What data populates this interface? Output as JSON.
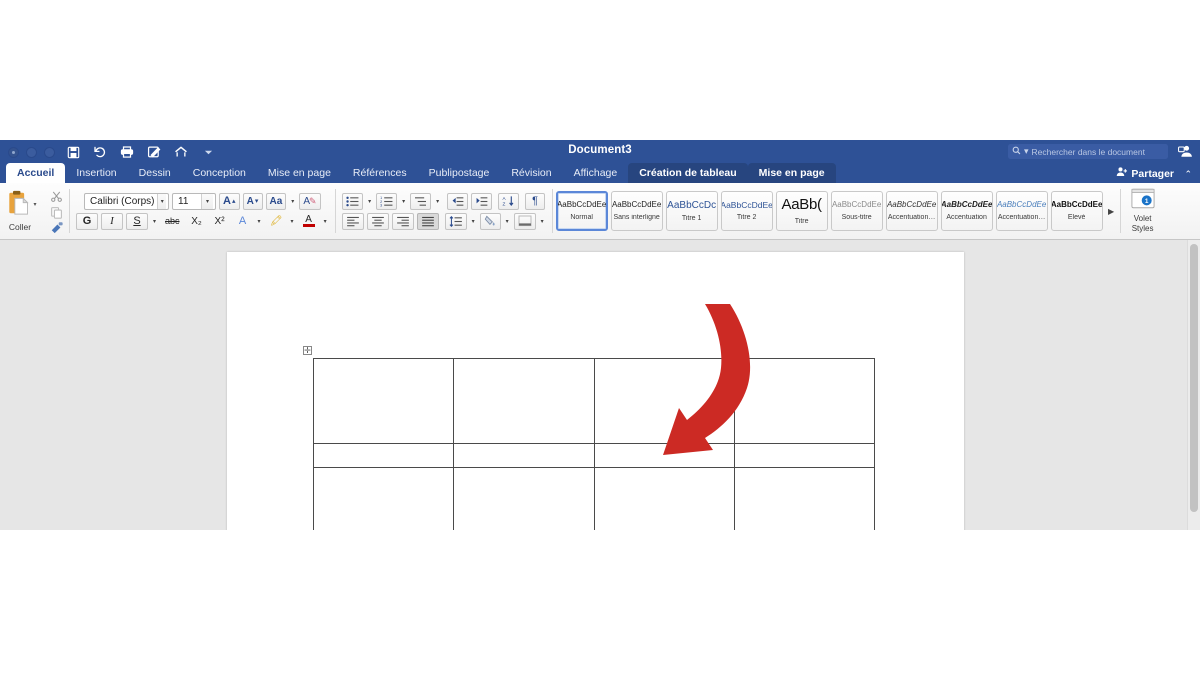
{
  "window": {
    "title": "Document3",
    "traffic_lights": [
      "close",
      "minimize",
      "zoom"
    ]
  },
  "quick_access": [
    {
      "name": "save-icon",
      "label": "Enregistrer"
    },
    {
      "name": "undo-icon",
      "label": "Annuler"
    },
    {
      "name": "print-icon",
      "label": "Imprimer"
    },
    {
      "name": "track-changes-icon",
      "label": "Suivi des modifications"
    },
    {
      "name": "home-icon",
      "label": "Accueil"
    },
    {
      "name": "chevron-down-icon",
      "label": "Personnaliser"
    }
  ],
  "search": {
    "placeholder": "Rechercher dans le document",
    "icon": "search-icon"
  },
  "share": {
    "label": "Partager",
    "icon": "person-add-icon"
  },
  "tabs": [
    {
      "label": "Accueil",
      "state": "active"
    },
    {
      "label": "Insertion",
      "state": "normal"
    },
    {
      "label": "Dessin",
      "state": "normal"
    },
    {
      "label": "Conception",
      "state": "normal"
    },
    {
      "label": "Mise en page",
      "state": "normal"
    },
    {
      "label": "Références",
      "state": "normal"
    },
    {
      "label": "Publipostage",
      "state": "normal"
    },
    {
      "label": "Révision",
      "state": "normal"
    },
    {
      "label": "Affichage",
      "state": "normal"
    },
    {
      "label": "Création de tableau",
      "state": "contextual"
    },
    {
      "label": "Mise en page",
      "state": "contextual"
    }
  ],
  "ribbon": {
    "clipboard": {
      "paste_label": "Coller",
      "paste_icon": "clipboard-icon",
      "cut_icon": "scissors-icon",
      "copy_icon": "copy-icon",
      "painter_icon": "format-painter-icon"
    },
    "font": {
      "name_value": "Calibri (Corps)",
      "size_value": "11",
      "grow_label": "A",
      "shrink_label": "A",
      "case_label": "Aa",
      "clear_label": "A",
      "bold_label": "G",
      "italic_label": "I",
      "underline_label": "S",
      "strike_label": "abc",
      "subscript_label": "X₂",
      "superscript_label": "X²",
      "text_effects_label": "A",
      "highlight_label": "A",
      "color_label": "A"
    },
    "paragraph": {
      "bullets_icon": "bullet-list-icon",
      "numbering_icon": "numbered-list-icon",
      "multilevel_icon": "multilevel-list-icon",
      "decrease_indent_icon": "decrease-indent-icon",
      "increase_indent_icon": "increase-indent-icon",
      "sort_icon": "sort-az-icon",
      "marks_label": "¶",
      "align_left_icon": "align-left-icon",
      "align_center_icon": "align-center-icon",
      "align_right_icon": "align-right-icon",
      "justify_icon": "align-justify-icon",
      "line_spacing_icon": "line-spacing-icon",
      "shading_icon": "shading-icon",
      "borders_icon": "borders-icon"
    },
    "styles": [
      {
        "sample": "AaBbCcDdEe",
        "name": "Normal",
        "selected": true
      },
      {
        "sample": "AaBbCcDdEe",
        "name": "Sans interligne",
        "selected": false
      },
      {
        "sample": "AaBbCcDc",
        "name": "Titre 1",
        "selected": false
      },
      {
        "sample": "AaBbCcDdEe",
        "name": "Titre 2",
        "selected": false
      },
      {
        "sample": "AaBb(",
        "name": "Titre",
        "selected": false
      },
      {
        "sample": "AaBbCcDdEe",
        "name": "Sous-titre",
        "selected": false
      },
      {
        "sample": "AaBbCcDdEe",
        "name": "Accentuation…",
        "selected": false
      },
      {
        "sample": "AaBbCcDdEe",
        "name": "Accentuation",
        "selected": false
      },
      {
        "sample": "AaBbCcDdEe",
        "name": "Accentuation…",
        "selected": false
      },
      {
        "sample": "AaBbCcDdEe",
        "name": "Élevé",
        "selected": false
      }
    ],
    "styles_pane": {
      "label_line1": "Volet",
      "label_line2": "Styles",
      "badge": "1"
    }
  },
  "document": {
    "table": {
      "columns": 4,
      "rows": [
        {
          "type": "tall",
          "cells": [
            "",
            "",
            "",
            ""
          ]
        },
        {
          "type": "short",
          "cells": [
            "",
            "",
            "",
            ""
          ]
        },
        {
          "type": "tall",
          "cells": [
            "",
            "",
            "",
            ""
          ]
        }
      ],
      "move_handle": "table-move-handle",
      "resize_handle": "table-resize-handle",
      "cursor_cell": {
        "row": 1,
        "column": 1
      }
    },
    "annotation": {
      "type": "curved-arrow",
      "color": "#cc2a24",
      "points_to": "row-2-column-4"
    }
  },
  "colors": {
    "title_bar": "#2e5196",
    "contextual_tab": "#27457f",
    "canvas": "#e6e6e6",
    "page": "#ffffff",
    "arrow_red": "#cc2a24",
    "accent_blue": "#5b87d8"
  }
}
